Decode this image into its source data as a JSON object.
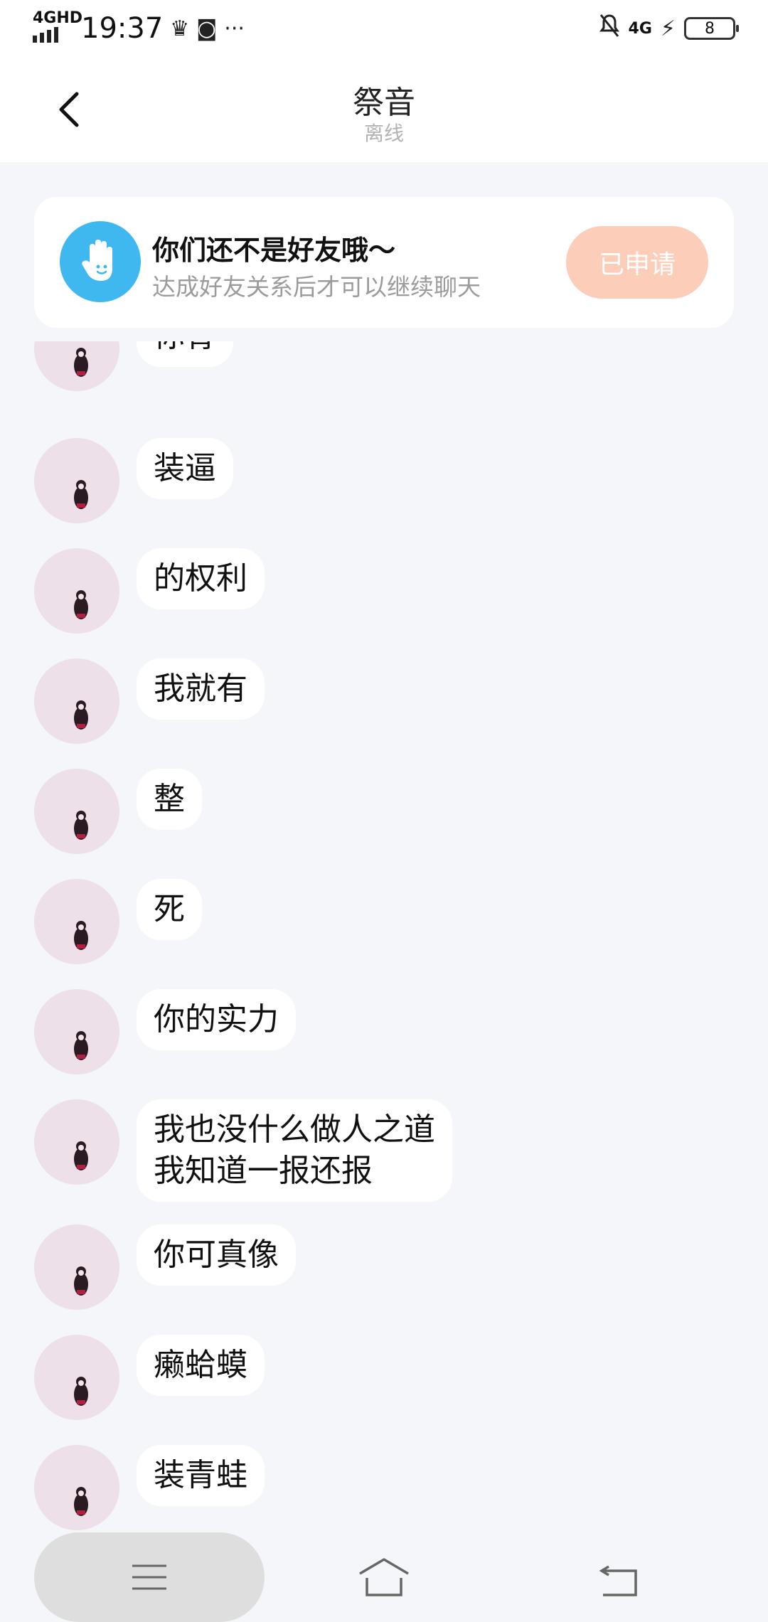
{
  "status_bar": {
    "network": "4GHD",
    "time": "19:37",
    "right_network": "4G",
    "battery": "8"
  },
  "header": {
    "title": "祭音",
    "status": "离线"
  },
  "friend_card": {
    "title": "你们还不是好友哦～",
    "subtitle": "达成好友关系后才可以继续聊天",
    "button": "已申请"
  },
  "messages": [
    {
      "text": "你骨"
    },
    {
      "text": "装逼"
    },
    {
      "text": "的权利"
    },
    {
      "text": "我就有"
    },
    {
      "text": "整"
    },
    {
      "text": "死"
    },
    {
      "text": "你的实力"
    },
    {
      "lines": [
        "我也没什么做人之道",
        "我知道一报还报"
      ]
    },
    {
      "text": "你可真像"
    },
    {
      "text": "癞蛤蟆"
    },
    {
      "text": "装青蛙"
    }
  ],
  "icons": {
    "back": "chevron-left-icon",
    "hand": "hand-wave-icon",
    "nav_menu": "menu-icon",
    "nav_home": "home-icon",
    "nav_back": "back-icon"
  }
}
